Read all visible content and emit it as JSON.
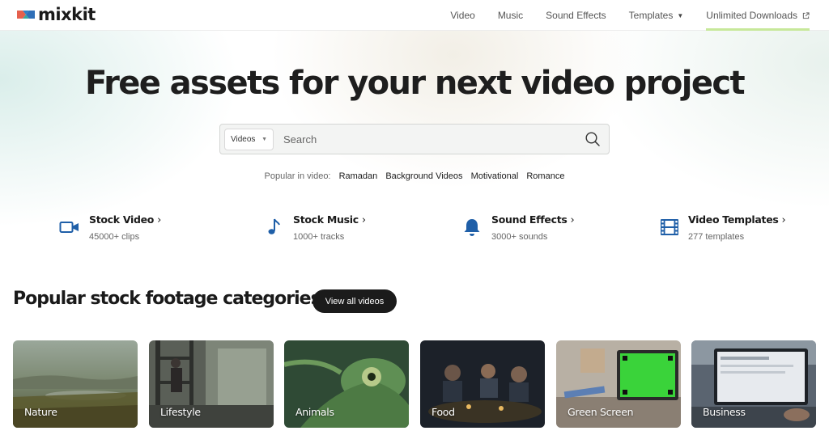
{
  "brand": {
    "name": "mixkit"
  },
  "nav": {
    "items": [
      {
        "label": "Video"
      },
      {
        "label": "Music"
      },
      {
        "label": "Sound Effects"
      },
      {
        "label": "Templates"
      },
      {
        "label": "Unlimited Downloads"
      }
    ]
  },
  "hero": {
    "title": "Free assets for your next video project",
    "search": {
      "selected_type": "Videos",
      "placeholder": "Search"
    },
    "popular": {
      "label": "Popular in video:",
      "tags": [
        "Ramadan",
        "Background Videos",
        "Motivational",
        "Romance"
      ]
    }
  },
  "features": [
    {
      "title": "Stock Video",
      "subtitle": "45000+ clips",
      "icon": "video-camera-icon"
    },
    {
      "title": "Stock Music",
      "subtitle": "1000+ tracks",
      "icon": "music-note-icon"
    },
    {
      "title": "Sound Effects",
      "subtitle": "3000+ sounds",
      "icon": "bell-icon"
    },
    {
      "title": "Video Templates",
      "subtitle": "277 templates",
      "icon": "film-strip-icon"
    }
  ],
  "categories": {
    "title": "Popular stock footage categories",
    "view_all": "View all videos",
    "items": [
      {
        "label": "Nature"
      },
      {
        "label": "Lifestyle"
      },
      {
        "label": "Animals"
      },
      {
        "label": "Food"
      },
      {
        "label": "Green Screen"
      },
      {
        "label": "Business"
      }
    ]
  },
  "colors": {
    "accent_blue": "#1f5fa8",
    "nav_active_underline": "#c7e89a",
    "dark_button": "#1b1b1b"
  }
}
